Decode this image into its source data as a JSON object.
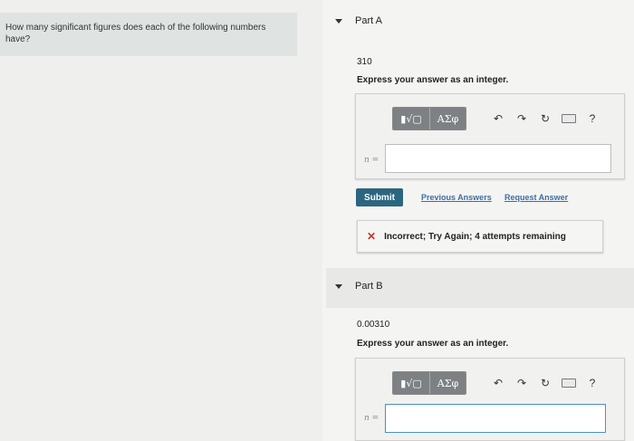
{
  "question": {
    "text": "How many significant figures does each of the following numbers have?"
  },
  "toolbar": {
    "template_label": "▮√▢",
    "symbols_label": "ΑΣφ",
    "undo_icon": "↶",
    "redo_icon": "↷",
    "reset_icon": "↻",
    "help_label": "?"
  },
  "part_a": {
    "title": "Part A",
    "number": "310",
    "instruction": "Express your answer as an integer.",
    "variable_label": "n =",
    "answer_value": "",
    "submit_label": "Submit",
    "previous_answers_label": "Previous Answers",
    "request_answer_label": "Request Answer",
    "feedback": "Incorrect; Try Again; 4 attempts remaining"
  },
  "part_b": {
    "title": "Part B",
    "number": "0.00310",
    "instruction": "Express your answer as an integer.",
    "variable_label": "n =",
    "answer_value": ""
  },
  "colors": {
    "submit_bg": "#2b6680",
    "link": "#3c6ea3",
    "error": "#c0392b",
    "focus_border": "#4a90c8"
  }
}
